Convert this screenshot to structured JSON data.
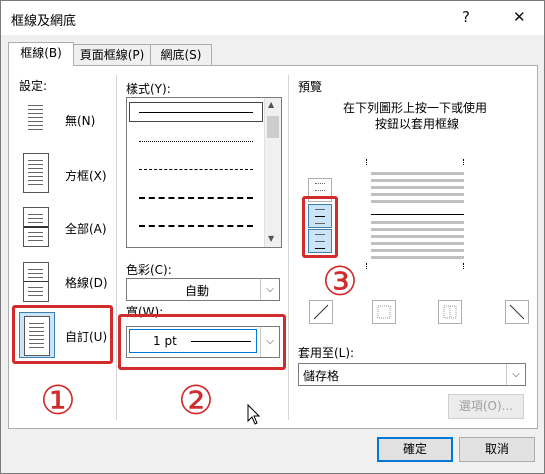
{
  "title": "框線及網底",
  "title_buttons": {
    "help": "?",
    "close": "✕"
  },
  "tabs": [
    {
      "label": "框線(B)"
    },
    {
      "label": "頁面框線(P)"
    },
    {
      "label": "網底(S)"
    }
  ],
  "setting": {
    "label": "設定:",
    "items": [
      {
        "label": "無(N)"
      },
      {
        "label": "方框(X)"
      },
      {
        "label": "全部(A)"
      },
      {
        "label": "格線(D)"
      },
      {
        "label": "自訂(U)"
      }
    ],
    "selected": "自訂(U)"
  },
  "style": {
    "label": "樣式(Y):",
    "scroll_up": "▲",
    "scroll_down": "▼"
  },
  "color": {
    "label": "色彩(C):",
    "value": "自動"
  },
  "width": {
    "label": "寬(W):",
    "value": "1 pt"
  },
  "preview": {
    "label": "預覽",
    "instruction_line1": "在下列圖形上按一下或使用",
    "instruction_line2": "按鈕以套用框線"
  },
  "apply_to": {
    "label": "套用至(L):",
    "value": "儲存格"
  },
  "buttons": {
    "options": "選項(O)...",
    "ok": "確定",
    "cancel": "取消"
  },
  "annotations": {
    "one": "①",
    "two": "②",
    "three": "③"
  },
  "colors": {
    "accent": "#0078d7",
    "annotation_red": "#d12b2b",
    "selection": "#cce4f7"
  }
}
